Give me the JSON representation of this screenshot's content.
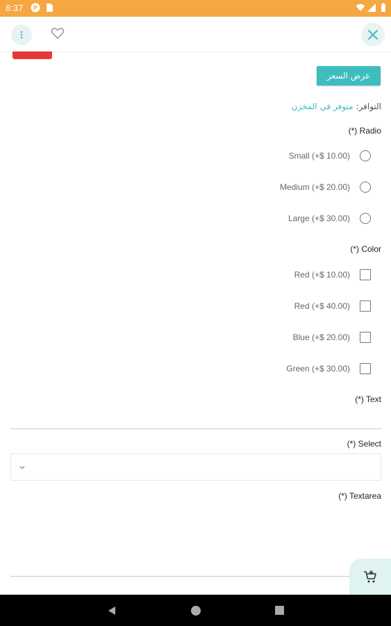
{
  "status_bar": {
    "time": "8:37",
    "icons": [
      "app-notification-icon",
      "sim-card-icon",
      "wifi-icon",
      "signal-icon",
      "battery-icon"
    ],
    "color": "#f5a742"
  },
  "app_bar": {
    "icons": [
      "more-vertical-icon",
      "heart-icon",
      "close-icon"
    ]
  },
  "price_button": {
    "label": "عرض السعر"
  },
  "availability": {
    "label": "التوافر:",
    "status": "متوفر في المخزن"
  },
  "radio_group": {
    "title": "(*) Radio",
    "options": [
      {
        "label": "Small (+$ 10.00)"
      },
      {
        "label": "Medium (+$ 20.00)"
      },
      {
        "label": "Large (+$ 30.00)"
      }
    ]
  },
  "color_group": {
    "title": "(*) Color",
    "options": [
      {
        "label": "Red (+$ 10.00)"
      },
      {
        "label": "Red (+$ 40.00)"
      },
      {
        "label": "Blue (+$ 20.00)"
      },
      {
        "label": "Green (+$ 30.00)"
      }
    ]
  },
  "text_field": {
    "title": "(*) Text",
    "value": ""
  },
  "select_field": {
    "title": "(*) Select",
    "value": ""
  },
  "textarea_field": {
    "title": "(*) Textarea",
    "value": ""
  },
  "theme": {
    "accent": "#3ebdbf",
    "sale_badge": "#e53935"
  }
}
